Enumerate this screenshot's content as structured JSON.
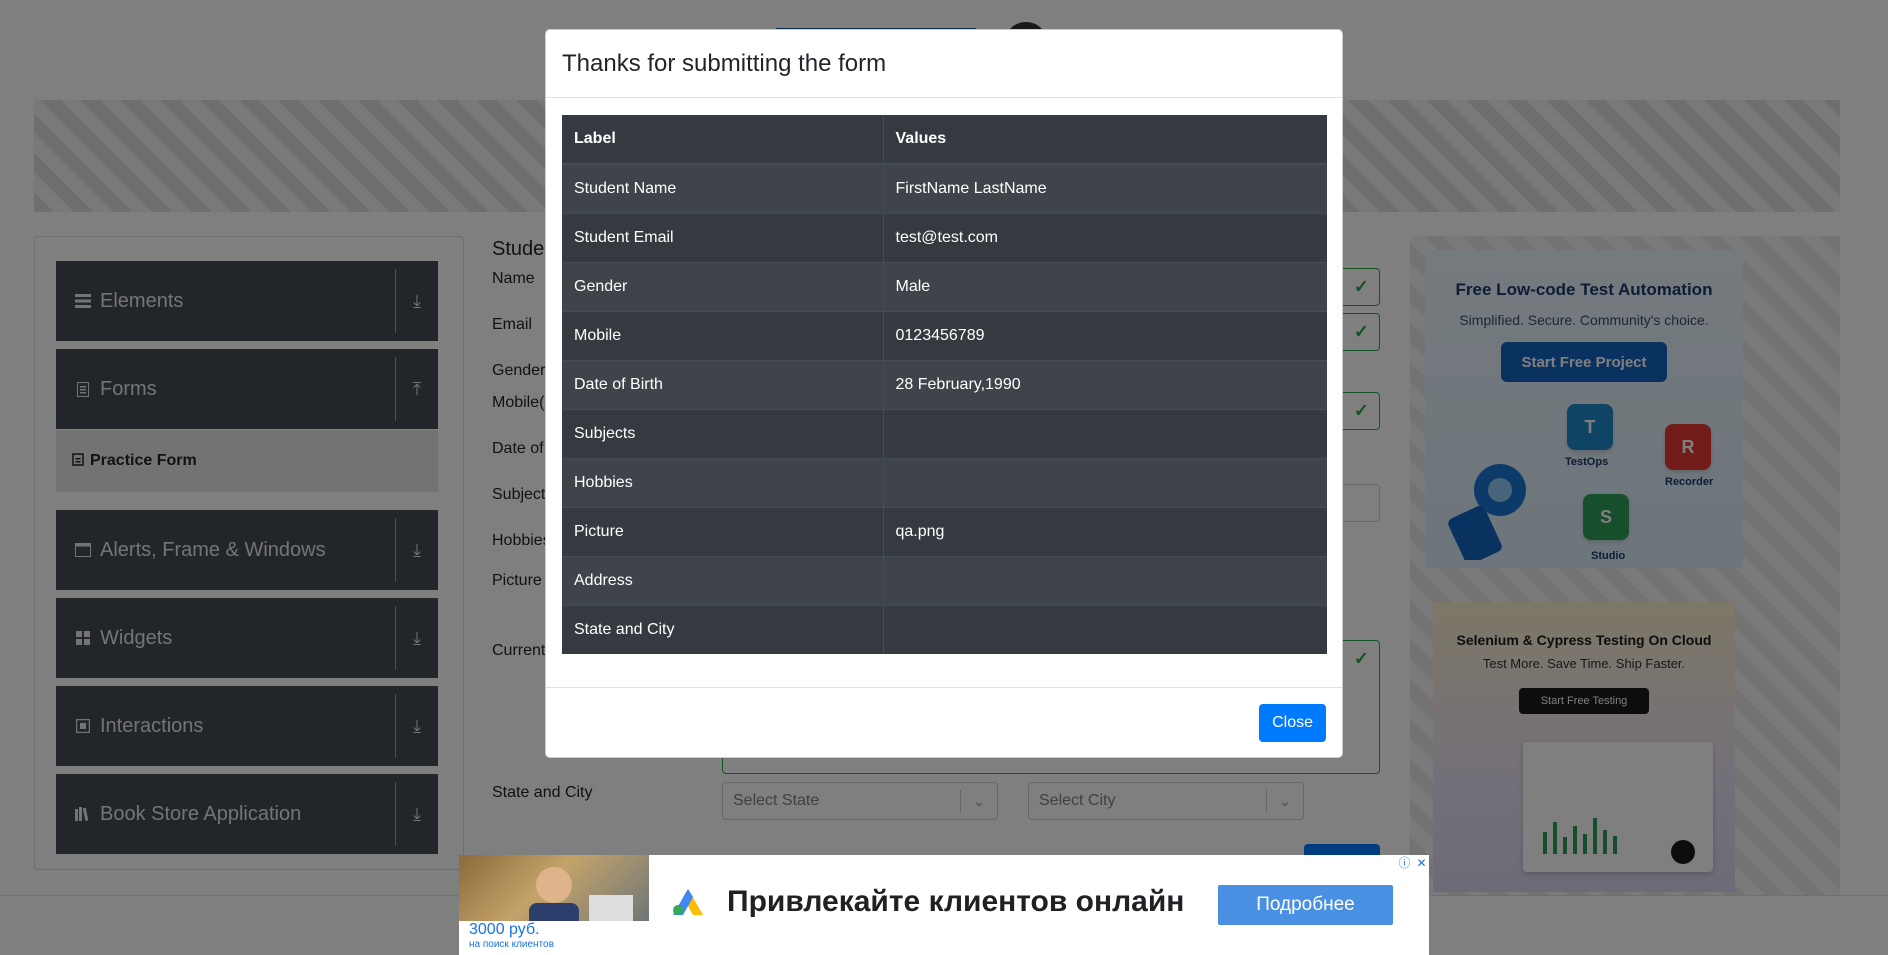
{
  "sidebar": {
    "groups": [
      {
        "label": "Elements",
        "icon": "list-icon"
      },
      {
        "label": "Forms",
        "icon": "document-icon"
      },
      {
        "label": "Alerts, Frame & Windows",
        "icon": "window-icon"
      },
      {
        "label": "Widgets",
        "icon": "widgets-icon"
      },
      {
        "label": "Interactions",
        "icon": "interactions-icon"
      },
      {
        "label": "Book Store Application",
        "icon": "books-icon"
      }
    ],
    "active_item": "Practice Form"
  },
  "form": {
    "title_partial": "Stude",
    "labels": {
      "name": "Name",
      "email": "Email",
      "gender": "Gender",
      "mobile": "Mobile(",
      "dob": "Date of",
      "subjects": "Subject",
      "hobbies": "Hobbies",
      "picture": "Picture",
      "current_address": "Current",
      "state_city": "State and City"
    },
    "state_placeholder": "Select State",
    "city_placeholder": "Select City"
  },
  "side_ads": {
    "ad1": {
      "title": "Free Low-code Test Automation",
      "subtitle": "Simplified. Secure. Community's choice.",
      "button": "Start Free Project",
      "products": [
        "TestOps",
        "Recorder",
        "Studio"
      ]
    },
    "ad2": {
      "title": "Selenium & Cypress Testing On Cloud",
      "subtitle": "Test More. Save Time. Ship Faster.",
      "button": "Start Free Testing"
    }
  },
  "modal": {
    "title": "Thanks for submitting the form",
    "table": {
      "headers": [
        "Label",
        "Values"
      ],
      "rows": [
        {
          "label": "Student Name",
          "value": "FirstName LastName"
        },
        {
          "label": "Student Email",
          "value": "test@test.com"
        },
        {
          "label": "Gender",
          "value": "Male"
        },
        {
          "label": "Mobile",
          "value": "0123456789"
        },
        {
          "label": "Date of Birth",
          "value": "28 February,1990"
        },
        {
          "label": "Subjects",
          "value": ""
        },
        {
          "label": "Hobbies",
          "value": ""
        },
        {
          "label": "Picture",
          "value": "qa.png"
        },
        {
          "label": "Address",
          "value": ""
        },
        {
          "label": "State and City",
          "value": ""
        }
      ]
    },
    "close_label": "Close"
  },
  "bottom_ad": {
    "headline": "Привлекайте клиентов онлайн",
    "cta": "Подробнее",
    "price": "3000 руб.",
    "price_caption": "на поиск клиентов"
  },
  "colors": {
    "primary": "#007bff",
    "table_dark": "#343a40",
    "sidebar_group": "#444b52",
    "valid": "#28a745"
  }
}
